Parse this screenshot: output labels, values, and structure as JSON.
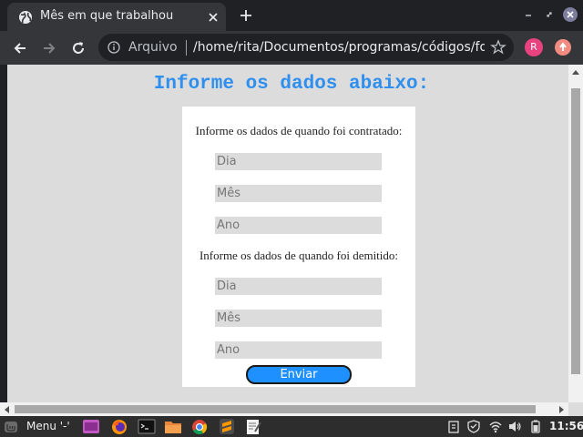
{
  "browser": {
    "tab_title": "Mês em que trabalhou",
    "omnibox_label": "Arquivo",
    "url": "/home/rita/Documentos/programas/códigos/for...",
    "profile_initial": "R"
  },
  "page": {
    "heading": "Informe os dados abaixo:",
    "hired_label": "Informe os dados de quando foi contratado:",
    "fired_label": "Informe os dados de quando foi demitido:",
    "hired_fields": {
      "day_placeholder": "Dia",
      "month_placeholder": "Mês",
      "year_placeholder": "Ano"
    },
    "fired_fields": {
      "day_placeholder": "Dia",
      "month_placeholder": "Mês",
      "year_placeholder": "Ano"
    },
    "submit_label": "Enviar"
  },
  "taskbar": {
    "menu_label": "Menu '-'",
    "clock": "11:56"
  },
  "colors": {
    "heading": "#2e8fef",
    "button": "#1e90ff",
    "page_background": "#dcdcdc"
  }
}
